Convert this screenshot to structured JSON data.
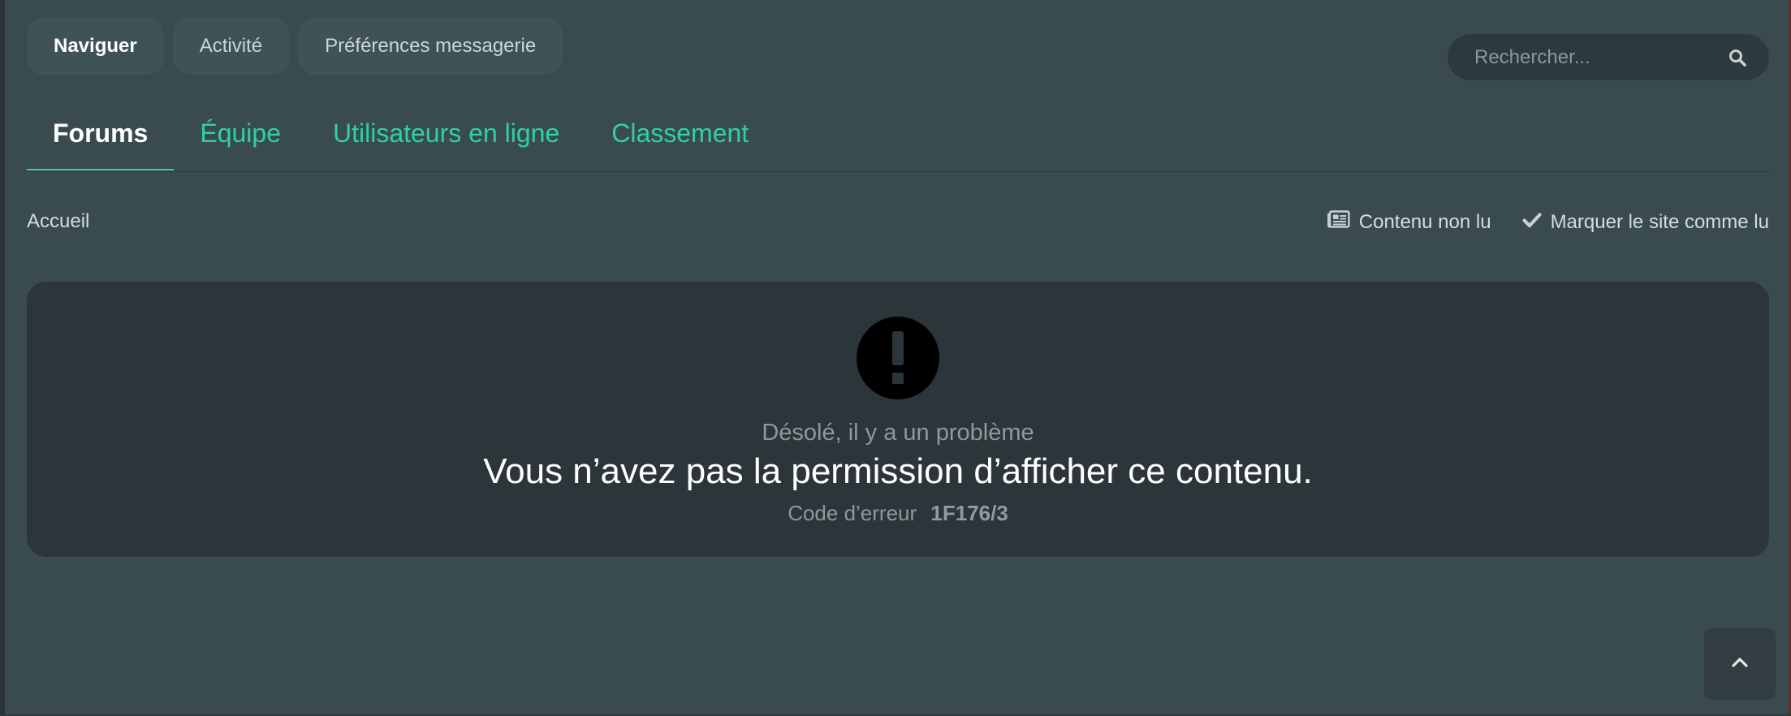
{
  "nav": {
    "pills": [
      {
        "label": "Naviguer",
        "active": true
      },
      {
        "label": "Activité",
        "active": false
      },
      {
        "label": "Préférences messagerie",
        "active": false
      }
    ]
  },
  "search": {
    "placeholder": "Rechercher...",
    "icon": "search-icon"
  },
  "tabs": [
    {
      "label": "Forums",
      "active": true
    },
    {
      "label": "Équipe",
      "active": false
    },
    {
      "label": "Utilisateurs en ligne",
      "active": false
    },
    {
      "label": "Classement",
      "active": false
    }
  ],
  "breadcrumb": {
    "home": "Accueil"
  },
  "actions": {
    "unread": {
      "label": "Contenu non lu",
      "icon": "newspaper-icon"
    },
    "mark_read": {
      "label": "Marquer le site comme lu",
      "icon": "check-icon"
    }
  },
  "error": {
    "icon": "exclamation-circle-icon",
    "subtitle": "Désolé, il y a un problème",
    "message": "Vous n’avez pas la permission d’afficher ce contenu.",
    "code_label": "Code d’erreur",
    "code": "1F176/3"
  },
  "colors": {
    "background": "#394b4f",
    "accent": "#2ed1a1",
    "panel": "#2c3539"
  }
}
